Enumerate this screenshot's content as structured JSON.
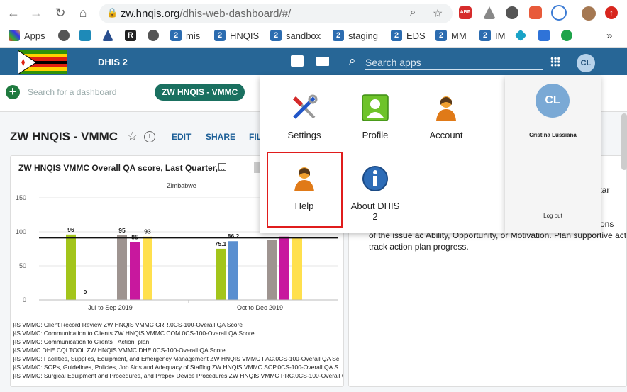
{
  "browser": {
    "url_host": "zw.hnqis.org",
    "url_path": "/dhis-web-dashboard/#/",
    "bookmarks": [
      {
        "label": "Apps",
        "icon": "apps-grid-icon"
      },
      {
        "label": "",
        "icon": "globe-icon"
      },
      {
        "label": "",
        "icon": "map-pin-icon"
      },
      {
        "label": "",
        "icon": "drive-triangle-icon"
      },
      {
        "label": "",
        "icon": "r-logo-icon"
      },
      {
        "label": "",
        "icon": "globe-icon"
      },
      {
        "label": "mis",
        "icon": "dhis2-icon"
      },
      {
        "label": "HNQIS",
        "icon": "dhis2-icon"
      },
      {
        "label": "sandbox",
        "icon": "dhis2-icon"
      },
      {
        "label": "staging",
        "icon": "dhis2-icon"
      },
      {
        "label": "EDS",
        "icon": "dhis2-icon"
      },
      {
        "label": "MM",
        "icon": "dhis2-icon"
      },
      {
        "label": "IM",
        "icon": "dhis2-icon"
      },
      {
        "label": "",
        "icon": "layers-icon"
      },
      {
        "label": "",
        "icon": "jira-icon"
      },
      {
        "label": "",
        "icon": "green-headset-icon"
      }
    ],
    "overflow": "»"
  },
  "header": {
    "title": "DHIS 2",
    "search_placeholder": "Search apps",
    "avatar_initials": "CL"
  },
  "controls": {
    "search_placeholder": "Search for a dashboard",
    "active_chip": "ZW HNQIS - VMMC"
  },
  "dashboard": {
    "title": "ZW HNQIS - VMMC",
    "edit": "EDIT",
    "share": "SHARE",
    "filter": "FIL"
  },
  "card1": {
    "title": "ZW HNQIS VMMC Overall QA score, Last Quarter,..."
  },
  "chart_data": {
    "type": "bar",
    "subtitle": "Zimbabwe",
    "categories": [
      "Jul to Sep 2019",
      "Oct to Dec 2019"
    ],
    "ylim": [
      0,
      150
    ],
    "yticks": [
      0,
      50,
      100,
      150
    ],
    "target_line": 91,
    "series": [
      {
        "color": "#a3c51b",
        "values": [
          96,
          75.1
        ]
      },
      {
        "color": "#2a2a2a",
        "values": [
          0,
          null
        ]
      },
      {
        "color": "#5a8fd0",
        "values": [
          null,
          86.2
        ]
      },
      {
        "color": "#9e9490",
        "values": [
          95,
          88
        ]
      },
      {
        "color": "#c8189e",
        "values": [
          85,
          93
        ]
      },
      {
        "color": "#ffe04d",
        "values": [
          93,
          91
        ]
      }
    ],
    "labels": [
      [
        "96",
        "0",
        "",
        "95",
        "85",
        "93"
      ],
      [
        "75.1",
        "",
        "86.2",
        "",
        "",
        ""
      ]
    ],
    "legend": [
      "}IS VMMC: Client Record Review ZW HNQIS VMMC CRR.0CS-100-Overall QA Score",
      "}IS VMMC: Communication to Clients ZW HNQIS VMMC COM.0CS-100-Overall QA Score",
      "}IS VMMC: Communication to Clients _Action_plan",
      "}IS VMMC DHE CQI TOOL ZW HNQIS VMMC DHE.0CS-100-Overall QA Score",
      "}IS VMMC: Facilities, Supplies, Equipment, and Emergency Management ZW HNQIS VMMC FAC.0CS-100-Overall QA Sc",
      "}IS VMMC: SOPs, Guidelines, Policies, Job Aids and Adequacy of Staffing ZW HNQIS VMMC SOP.0CS-100-Overall QA S",
      "}IS VMMC: Surgical Equipment and Procedures, and Prepex Device Procedures ZW HNQIS VMMC PRC.0CS-100-Overall QA S"
    ]
  },
  "card2": {
    "frag1": "d to tar",
    "frag2": "e. Cons",
    "frag3": "of the issue ac Ability, Opportunity, or Motivation. Plan supportive activiti",
    "frag4": "track action plan progress."
  },
  "apps_menu": {
    "items": [
      {
        "label": "Settings"
      },
      {
        "label": "Profile"
      },
      {
        "label": "Account"
      },
      {
        "label": "Help"
      },
      {
        "label": "About DHIS 2"
      }
    ]
  },
  "profile": {
    "initials": "CL",
    "name": "Cristina Lussiana",
    "logout": "Log out"
  }
}
